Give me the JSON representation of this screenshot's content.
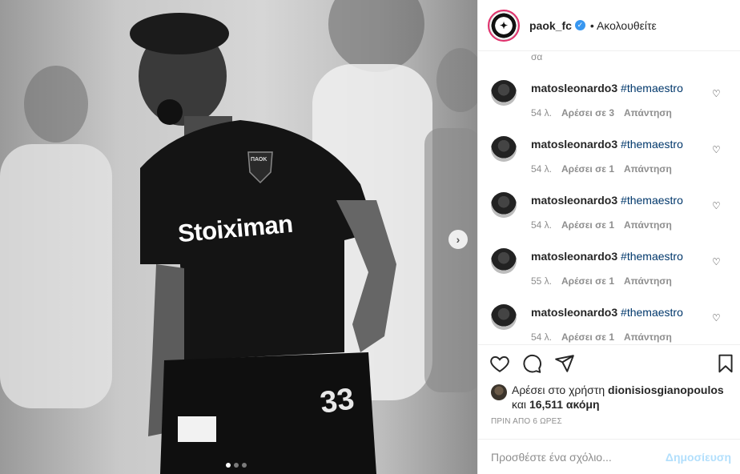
{
  "header": {
    "username": "paok_fc",
    "follow_label": "• Ακολουθείτε"
  },
  "comments": {
    "partial_text": "σα",
    "items": [
      {
        "user": "matosleonardo3",
        "tag": "#themaestro",
        "time": "54 λ.",
        "likes": "Αρέσει σε 3",
        "reply": "Απάντηση"
      },
      {
        "user": "matosleonardo3",
        "tag": "#themaestro",
        "time": "54 λ.",
        "likes": "Αρέσει σε 1",
        "reply": "Απάντηση"
      },
      {
        "user": "matosleonardo3",
        "tag": "#themaestro",
        "time": "54 λ.",
        "likes": "Αρέσει σε 1",
        "reply": "Απάντηση"
      },
      {
        "user": "matosleonardo3",
        "tag": "#themaestro",
        "time": "55 λ.",
        "likes": "Αρέσει σε 1",
        "reply": "Απάντηση"
      },
      {
        "user": "matosleonardo3",
        "tag": "#themaestro",
        "time": "54 λ.",
        "likes": "Αρέσει σε 1",
        "reply": "Απάντηση"
      }
    ]
  },
  "likes": {
    "prefix": "Αρέσει στο χρήστη",
    "user": "dionisiosgianopoulos",
    "and": "και",
    "count": "16,511 ακόμη"
  },
  "time_ago": "ΠΡΙΝ ΑΠΟ 6 ΩΡΕΣ",
  "add_comment": {
    "placeholder": "Προσθέστε ένα σχόλιο...",
    "post_label": "Δημοσίευση"
  },
  "photo": {
    "sponsor_text": "Stoiximan",
    "crest_text": "ΠΑΟΚ",
    "shirt_number": "33",
    "carousel_total": 3,
    "carousel_active": 1
  },
  "icons": [
    "heart-icon",
    "comment-icon",
    "share-icon",
    "bookmark-icon",
    "chevron-right-icon",
    "verified-icon"
  ]
}
